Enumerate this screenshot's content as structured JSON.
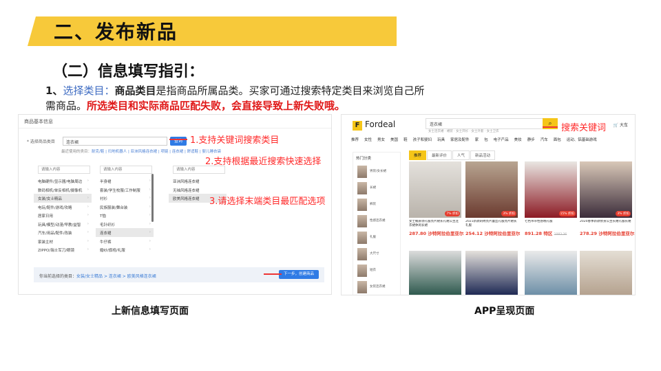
{
  "header": {
    "title": "二、发布新品",
    "subtitle": "（二）信息填写指引："
  },
  "intro": {
    "num": "1、",
    "heading": "选择类目：",
    "bold_term": "商品类目",
    "line_a": "是指商品所属品类。买家可通过搜索特定类目来浏览自己所需商品。",
    "warning": "所选类目和实际商品匹配失败，会直接导致上新失败哦。"
  },
  "left_shot": {
    "header": "商品基本信息",
    "field_label": "* 选择商品类目",
    "search_value": "连衣裙",
    "search_btn": "查询",
    "recent_label": "最近使用的类目：",
    "recent_items": "耐克/鞋 | 扫地机器人 | 亚洲风格连衣裙 | 项链 | 连衣裙 | 舒适鞋 | 婴儿睡衣袋",
    "col1_placeholder": "请输入内容",
    "col2_placeholder": "请输入内容",
    "col3_placeholder": "请输入内容",
    "col1": [
      "电脑硬件/显示器/电脑周边",
      "数码相机/单反相机/摄像机",
      "女装/女士精品",
      "电玩/配件/游戏/攻略",
      "居家日用",
      "玩具/模型/动漫/早教/益智",
      "汽车/用品/配件/改装",
      "家装主材",
      "ZIPPO/瑞士军刀/眼镜"
    ],
    "col2": [
      "半身裙",
      "套装/学生校服/工作制服",
      "衬衫",
      "民族服装/舞台装",
      "T恤",
      "毛针织衫",
      "连衣裙",
      "牛仔裤",
      "婚纱/旗袍/礼服"
    ],
    "col3": [
      "亚洲风格连衣裙",
      "无袖风格连衣裙",
      "欧美风格连衣裙"
    ],
    "bottom_label": "你当前选择的类目：",
    "bottom_path": "女装/女士精品 > 连衣裙 > 欧美风格连衣裙",
    "next_btn": "下一步，创建商品",
    "annotation_1": "1.支持关键词搜索类目",
    "annotation_2": "2.支持根据最近搜索快速选择",
    "annotation_3": "3.请选择末端类目最匹配选项"
  },
  "right_shot": {
    "logo_letter": "F",
    "logo_text": "Fordeal",
    "search_value": "连衣裙",
    "search_icon_glyph": "⌕",
    "hot_words": "女士连衣裙 · 裙装 · 女士开衫 · 女士外套 · 女士卫衣",
    "cart_label": "🛒 大车",
    "nav": [
      "推荐",
      "女性",
      "男女",
      "美国",
      "鞋",
      "孩子和婴妇",
      "玩具",
      "家居及配件",
      "家",
      "包",
      "电子产品",
      "美妆",
      "静步",
      "汽车",
      "面包",
      "运动、铝基础游戏"
    ],
    "side_title": "热门分类",
    "side_items": [
      "男装/女长裙",
      "长裙",
      "裤装",
      "性感连衣裙",
      "礼服",
      "大尺寸",
      "短衣",
      "女装连衣裙"
    ],
    "tabs": [
      "推荐",
      "最新评价",
      "人气",
      "新品活动"
    ],
    "products": [
      {
        "name": "女士桶质领礼服亮片裙长礼裙公主连衣裙休闲长裙",
        "price": "287.80 沙特阿拉伯里亚尔",
        "badge": "7% 折扣"
      },
      {
        "name": "2021新款刺绣亮片蕾丝礼服亮片裙长礼服",
        "price": "254.12 沙特阿拉伯里亚尔",
        "badge": "3% 折扣"
      },
      {
        "name": "七色吊带性感晚礼服",
        "price": "891.28 特区",
        "old_price": "1083.36",
        "badge": "15% 折扣"
      },
      {
        "name": "2020春季新款修身公主长裙礼服长裙",
        "price": "278.29 沙特阿拉伯里亚尔",
        "badge": "3% 折扣"
      }
    ],
    "annotation": "搜索关键词"
  },
  "captions": {
    "left": "上新信息填写页面",
    "right": "APP呈现页面"
  },
  "colors": {
    "banner": "#f7c93a",
    "annotation": "#ff2a2a",
    "accent_blue": "#2f7be5",
    "brand_yellow": "#f5c518",
    "warning": "#e01818"
  }
}
